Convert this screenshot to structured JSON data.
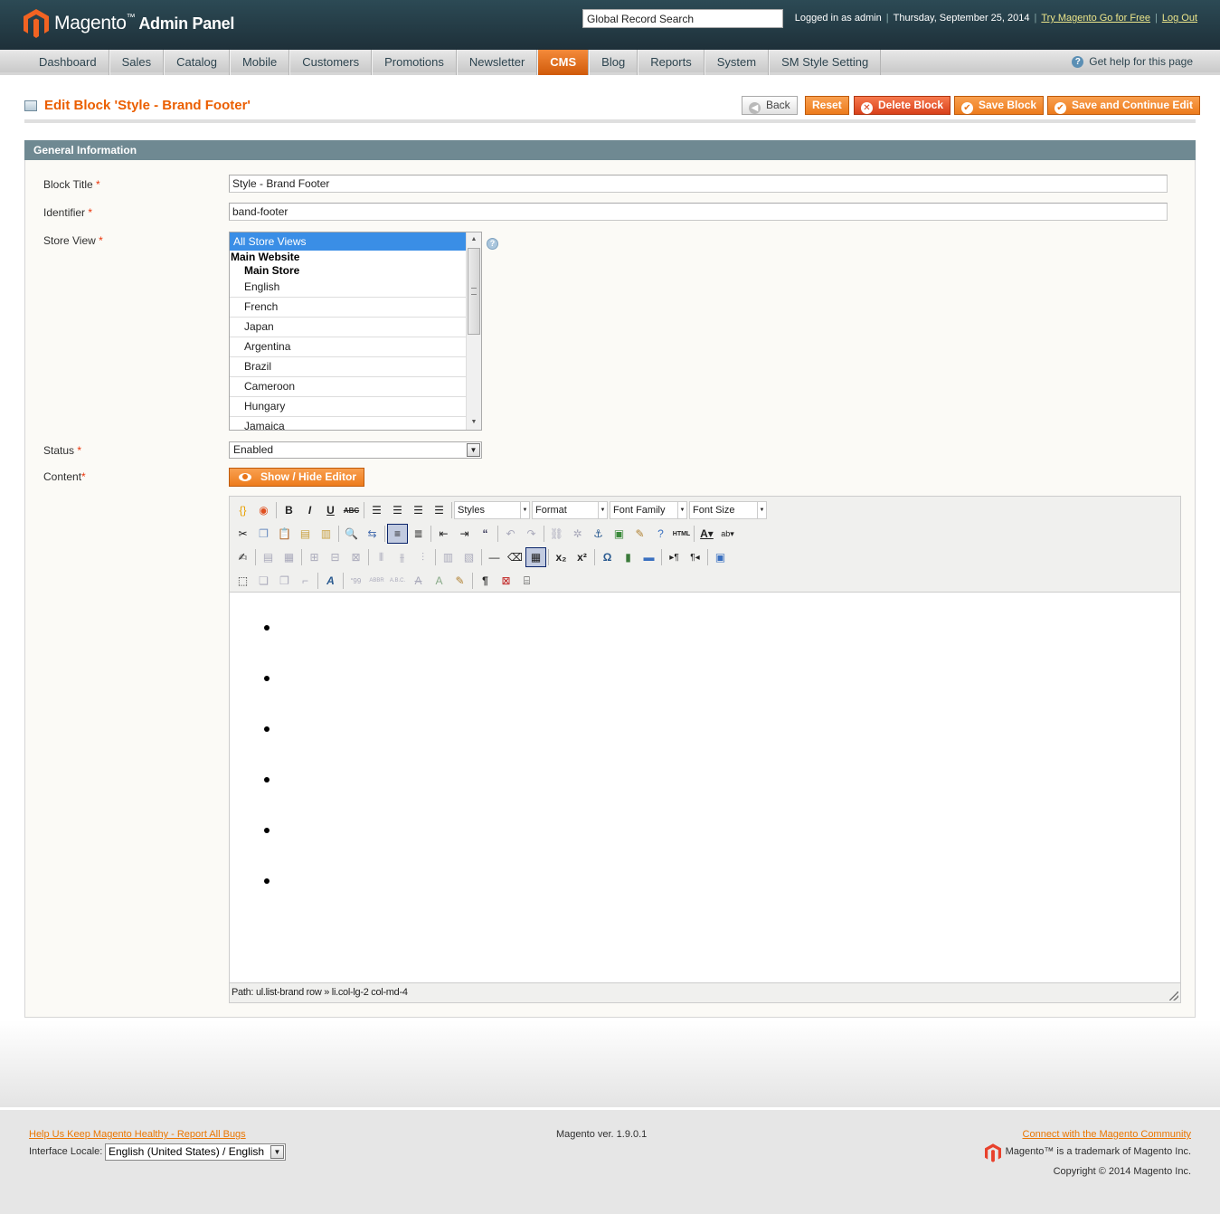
{
  "header": {
    "logo_text": "Magento",
    "logo_tm": "™",
    "logo_sub": "Admin Panel",
    "search_value": "Global Record Search",
    "logged_in": "Logged in as admin",
    "date": "Thursday, September 25, 2014",
    "try_link": "Try Magento Go for Free",
    "logout_link": "Log Out"
  },
  "nav": {
    "items": [
      "Dashboard",
      "Sales",
      "Catalog",
      "Mobile",
      "Customers",
      "Promotions",
      "Newsletter",
      "CMS",
      "Blog",
      "Reports",
      "System",
      "SM Style Setting"
    ],
    "active": "CMS",
    "help": "Get help for this page"
  },
  "page": {
    "title": "Edit Block 'Style - Brand Footer'",
    "buttons": {
      "back": "Back",
      "reset": "Reset",
      "delete": "Delete Block",
      "save": "Save Block",
      "save_continue": "Save and Continue Edit"
    }
  },
  "form": {
    "section_title": "General Information",
    "block_title_label": "Block Title",
    "block_title_value": "Style - Brand Footer",
    "identifier_label": "Identifier",
    "identifier_value": "band-footer",
    "store_view_label": "Store View",
    "store_view_options": {
      "selected": "All Store Views",
      "website": "Main Website",
      "store": "Main Store",
      "views": [
        "English",
        "French",
        "Japan",
        "Argentina",
        "Brazil",
        "Cameroon",
        "Hungary",
        "Jamaica"
      ]
    },
    "required_mark": "*",
    "status_label": "Status",
    "status_value": "Enabled",
    "content_label": "Content",
    "show_hide_editor": "Show / Hide Editor"
  },
  "editor": {
    "styles": "Styles",
    "format": "Format",
    "font_family": "Font Family",
    "font_size": "Font Size",
    "html_button": "HTML",
    "bullet_count": 6,
    "path": "Path: ul.list-brand row » li.col-lg-2 col-md-4"
  },
  "footer": {
    "report_bugs": "Help Us Keep Magento Healthy - Report All Bugs",
    "locale_label": "Interface Locale:",
    "locale_value": "English (United States) / English",
    "version": "Magento ver. 1.9.0.1",
    "community_link": "Connect with the Magento Community",
    "trademark": "Magento™ is a trademark of Magento Inc.",
    "copyright": "Copyright © 2014 Magento Inc."
  },
  "colors": {
    "accent_orange": "#eb5e00",
    "header_bg": "#1e3039",
    "section_head": "#6f8992"
  }
}
